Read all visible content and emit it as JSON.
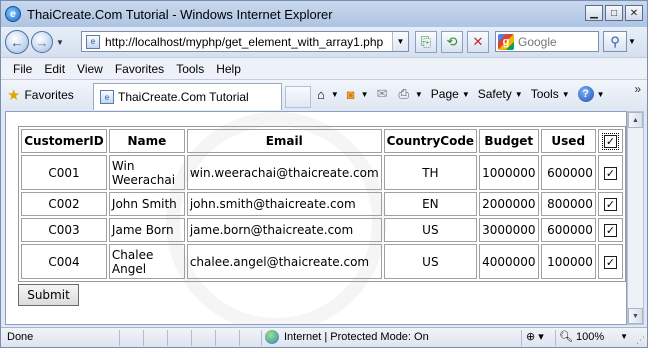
{
  "window": {
    "title": "ThaiCreate.Com Tutorial - Windows Internet Explorer"
  },
  "nav": {
    "url": "http://localhost/myphp/get_element_with_array1.php",
    "search_placeholder": "Google",
    "search_engine_icon": "google-icon"
  },
  "menu": [
    "File",
    "Edit",
    "View",
    "Favorites",
    "Tools",
    "Help"
  ],
  "favbar": {
    "favorites_label": "Favorites",
    "tab_title": "ThaiCreate.Com Tutorial",
    "commands": {
      "page": "Page",
      "safety": "Safety",
      "tools": "Tools"
    }
  },
  "table": {
    "headers": [
      "CustomerID",
      "Name",
      "Email",
      "CountryCode",
      "Budget",
      "Used"
    ],
    "header_checkbox_checked": true,
    "rows": [
      {
        "id": "C001",
        "name": "Win Weerachai",
        "email": "win.weerachai@thaicreate.com",
        "country": "TH",
        "budget": "1000000",
        "used": "600000",
        "checked": true
      },
      {
        "id": "C002",
        "name": "John Smith",
        "email": "john.smith@thaicreate.com",
        "country": "EN",
        "budget": "2000000",
        "used": "800000",
        "checked": true
      },
      {
        "id": "C003",
        "name": "Jame Born",
        "email": "jame.born@thaicreate.com",
        "country": "US",
        "budget": "3000000",
        "used": "600000",
        "checked": true
      },
      {
        "id": "C004",
        "name": "Chalee Angel",
        "email": "chalee.angel@thaicreate.com",
        "country": "US",
        "budget": "4000000",
        "used": "100000",
        "checked": true
      }
    ]
  },
  "submit_label": "Submit",
  "status": {
    "text": "Done",
    "zone": "Internet | Protected Mode: On",
    "zoom": "100%"
  }
}
